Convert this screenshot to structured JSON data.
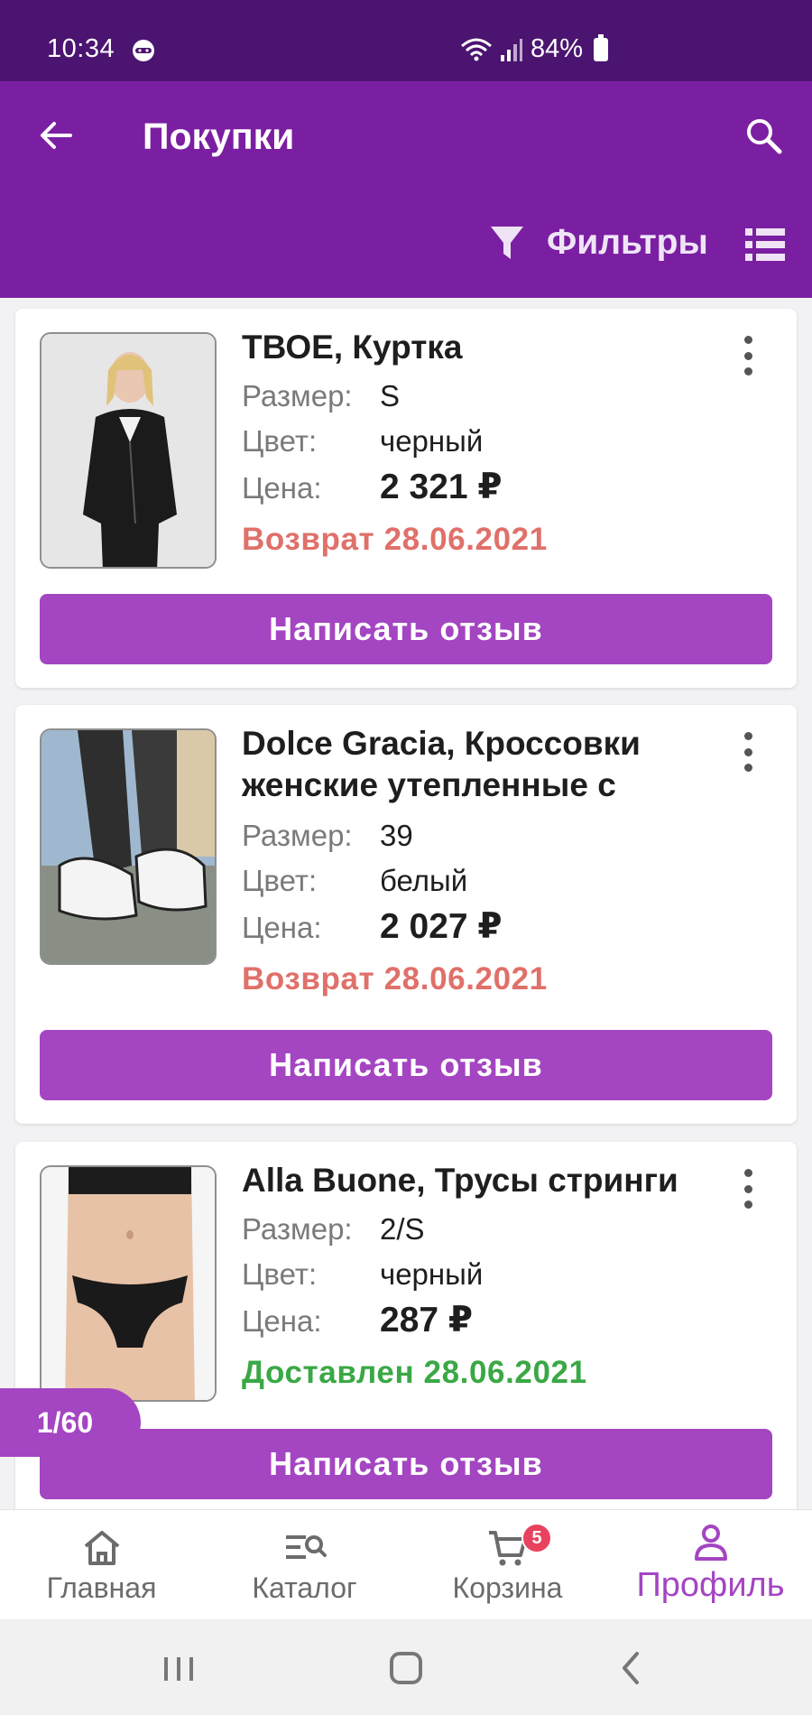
{
  "status_bar": {
    "time": "10:34",
    "battery": "84%"
  },
  "header": {
    "title": "Покупки",
    "filters_label": "Фильтры"
  },
  "items": [
    {
      "title": "ТВОЕ, Куртка",
      "size_label": "Размер:",
      "size": "S",
      "color_label": "Цвет:",
      "color": "черный",
      "price_label": "Цена:",
      "price": "2 321 ₽",
      "status": "Возврат 28.06.2021",
      "review_label": "Написать отзыв"
    },
    {
      "title": "Dolce Gracia, Кроссовки женские утепленные с",
      "size_label": "Размер:",
      "size": "39",
      "color_label": "Цвет:",
      "color": "белый",
      "price_label": "Цена:",
      "price": "2 027 ₽",
      "status": "Возврат 28.06.2021",
      "review_label": "Написать отзыв"
    },
    {
      "title": "Alla Buone, Трусы стринги",
      "size_label": "Размер:",
      "size": "2/S",
      "color_label": "Цвет:",
      "color": "черный",
      "price_label": "Цена:",
      "price": "287 ₽",
      "status": "Доставлен 28.06.2021",
      "review_label": "Написать отзыв"
    }
  ],
  "page_counter": "1/60",
  "bottom_nav": {
    "items": [
      {
        "label": "Главная",
        "icon": "home-icon"
      },
      {
        "label": "Каталог",
        "icon": "catalog-search-icon"
      },
      {
        "label": "Корзина",
        "icon": "cart-icon",
        "badge": "5"
      },
      {
        "label": "Профиль",
        "icon": "profile-icon",
        "active": true
      }
    ]
  },
  "colors": {
    "status_bar": "#4b1470",
    "app_bar": "#7b1fa2",
    "accent": "#a445c2",
    "return_status": "#e0706a",
    "delivered_status": "#3aa845",
    "badge": "#e8425f"
  }
}
